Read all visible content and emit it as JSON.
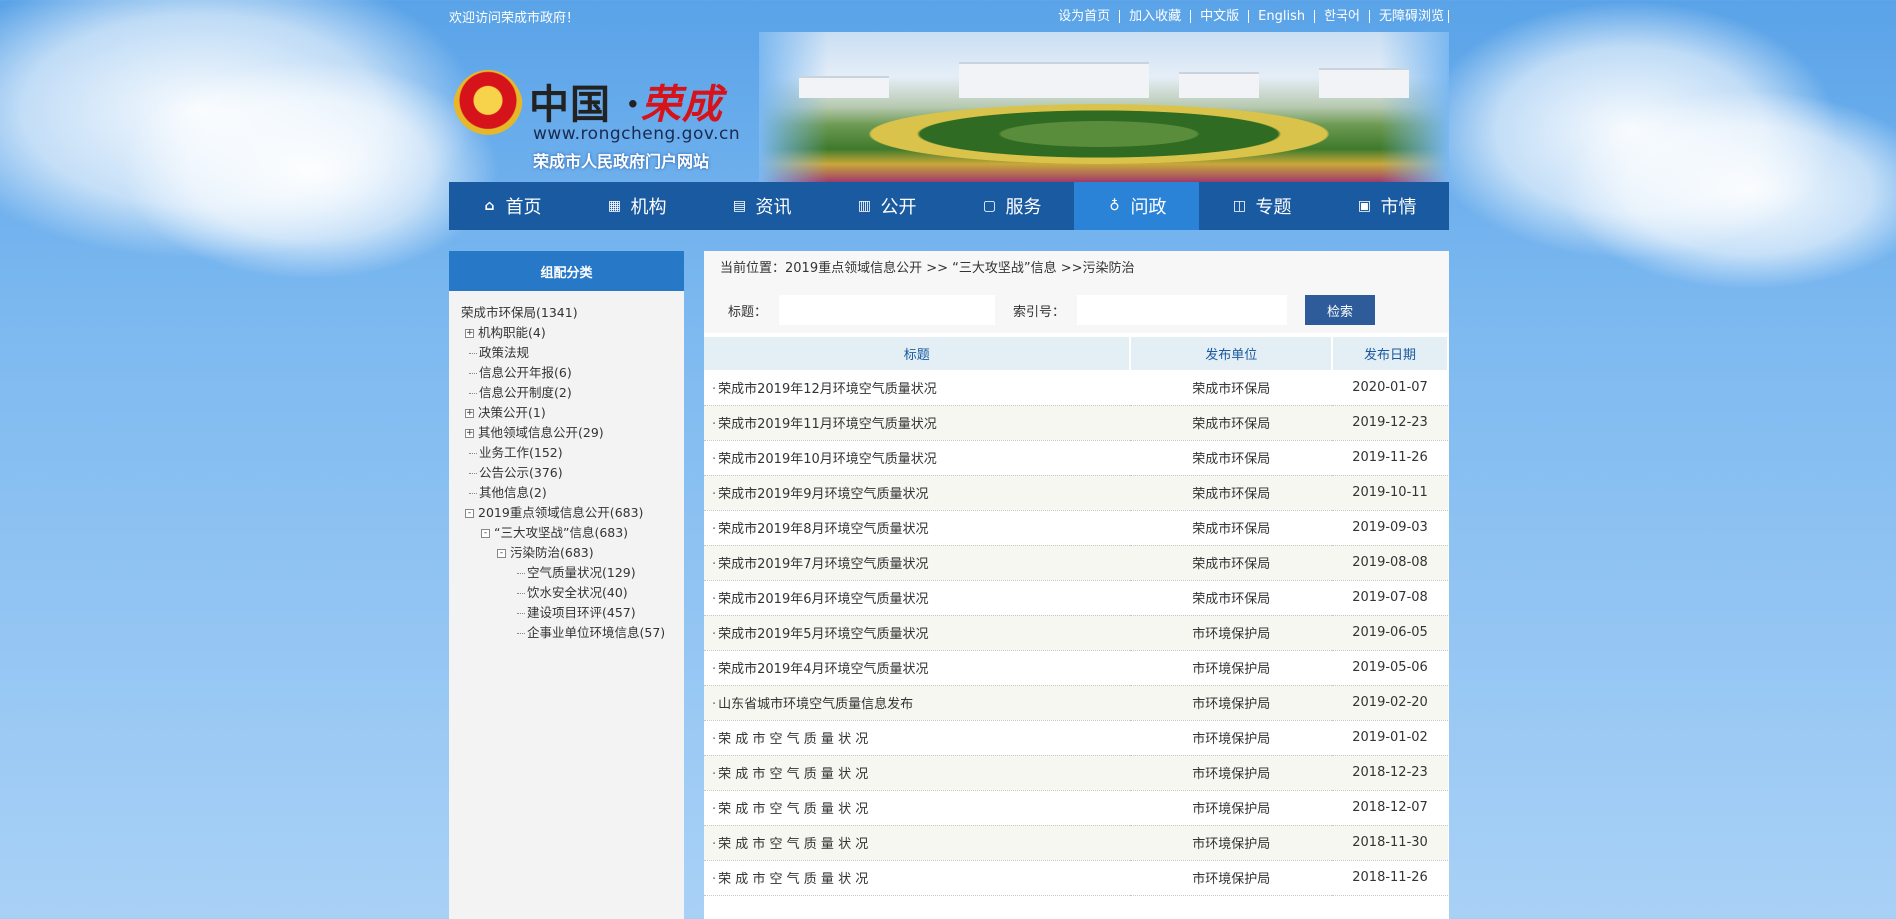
{
  "topbar": {
    "welcome": "欢迎访问荣成市政府！",
    "links": [
      "设为首页",
      "加入收藏",
      "中文版",
      "English",
      "한국어",
      "无障碍浏览"
    ]
  },
  "header": {
    "title_part1": "中国 ·",
    "title_part2": "荣成",
    "url": "www.rongcheng.gov.cn",
    "subtitle": "荣成市人民政府门户网站"
  },
  "nav": {
    "items": [
      {
        "label": "首页",
        "icon": "home-icon",
        "glyph": "⌂"
      },
      {
        "label": "机构",
        "icon": "organization-icon",
        "glyph": "▦"
      },
      {
        "label": "资讯",
        "icon": "news-icon",
        "glyph": "▤"
      },
      {
        "label": "公开",
        "icon": "book-icon",
        "glyph": "▥"
      },
      {
        "label": "服务",
        "icon": "service-icon",
        "glyph": "▢"
      },
      {
        "label": "问政",
        "icon": "user-icon",
        "glyph": "♁"
      },
      {
        "label": "专题",
        "icon": "topic-icon",
        "glyph": "◫"
      },
      {
        "label": "市情",
        "icon": "city-icon",
        "glyph": "▣"
      }
    ],
    "active_index": 5
  },
  "sidebar": {
    "heading": "组配分类",
    "tree": [
      {
        "label": "荣成市环保局(1341)",
        "level": 0,
        "toggle": ""
      },
      {
        "label": "机构职能(4)",
        "level": 1,
        "toggle": "+"
      },
      {
        "label": "政策法规",
        "level": 1,
        "toggle": ""
      },
      {
        "label": "信息公开年报(6)",
        "level": 1,
        "toggle": ""
      },
      {
        "label": "信息公开制度(2)",
        "level": 1,
        "toggle": ""
      },
      {
        "label": "决策公开(1)",
        "level": 1,
        "toggle": "+"
      },
      {
        "label": "其他领域信息公开(29)",
        "level": 1,
        "toggle": "+"
      },
      {
        "label": "业务工作(152)",
        "level": 1,
        "toggle": ""
      },
      {
        "label": "公告公示(376)",
        "level": 1,
        "toggle": ""
      },
      {
        "label": "其他信息(2)",
        "level": 1,
        "toggle": ""
      },
      {
        "label": "2019重点领域信息公开(683)",
        "level": 1,
        "toggle": "-"
      },
      {
        "label": "“三大攻坚战”信息(683)",
        "level": 2,
        "toggle": "-"
      },
      {
        "label": "污染防治(683)",
        "level": 3,
        "toggle": "-"
      },
      {
        "label": "空气质量状况(129)",
        "level": 4,
        "toggle": ""
      },
      {
        "label": "饮水安全状况(40)",
        "level": 4,
        "toggle": ""
      },
      {
        "label": "建设项目环评(457)",
        "level": 4,
        "toggle": ""
      },
      {
        "label": "企事业单位环境信息(57)",
        "level": 4,
        "toggle": ""
      }
    ]
  },
  "main": {
    "breadcrumb": "当前位置：2019重点领域信息公开 >> “三大攻坚战”信息 >>污染防治",
    "search": {
      "title_label": "标题：",
      "title_value": "",
      "index_label": "索引号：",
      "index_value": "",
      "button": "检索"
    },
    "table": {
      "headers": [
        "标题",
        "发布单位",
        "发布日期"
      ],
      "rows": [
        {
          "title": "荣成市2019年12月环境空气质量状况",
          "unit": "荣成市环保局",
          "date": "2020-01-07"
        },
        {
          "title": "荣成市2019年11月环境空气质量状况",
          "unit": "荣成市环保局",
          "date": "2019-12-23"
        },
        {
          "title": "荣成市2019年10月环境空气质量状况",
          "unit": "荣成市环保局",
          "date": "2019-11-26"
        },
        {
          "title": "荣成市2019年9月环境空气质量状况",
          "unit": "荣成市环保局",
          "date": "2019-10-11"
        },
        {
          "title": "荣成市2019年8月环境空气质量状况",
          "unit": "荣成市环保局",
          "date": "2019-09-03"
        },
        {
          "title": "荣成市2019年7月环境空气质量状况",
          "unit": "荣成市环保局",
          "date": "2019-08-08"
        },
        {
          "title": "荣成市2019年6月环境空气质量状况",
          "unit": "荣成市环保局",
          "date": "2019-07-08"
        },
        {
          "title": "荣成市2019年5月环境空气质量状况",
          "unit": "市环境保护局",
          "date": "2019-06-05"
        },
        {
          "title": "荣成市2019年4月环境空气质量状况",
          "unit": "市环境保护局",
          "date": "2019-05-06"
        },
        {
          "title": "山东省城市环境空气质量信息发布",
          "unit": "市环境保护局",
          "date": "2019-02-20"
        },
        {
          "title": "荣 成 市 空 气 质 量 状 况",
          "unit": "市环境保护局",
          "date": "2019-01-02"
        },
        {
          "title": "荣 成 市 空 气 质 量 状 况",
          "unit": "市环境保护局",
          "date": "2018-12-23"
        },
        {
          "title": "荣 成 市 空 气 质 量 状 况",
          "unit": "市环境保护局",
          "date": "2018-12-07"
        },
        {
          "title": "荣 成 市 空 气 质 量 状 况",
          "unit": "市环境保护局",
          "date": "2018-11-30"
        },
        {
          "title": "荣 成 市 空 气 质 量 状 况",
          "unit": "市环境保护局",
          "date": "2018-11-26"
        }
      ]
    }
  },
  "colors": {
    "nav_bg": "#1a5aa0",
    "nav_active": "#2b83d8",
    "side_head": "#2878c8",
    "search_button": "#2e5c9a"
  }
}
